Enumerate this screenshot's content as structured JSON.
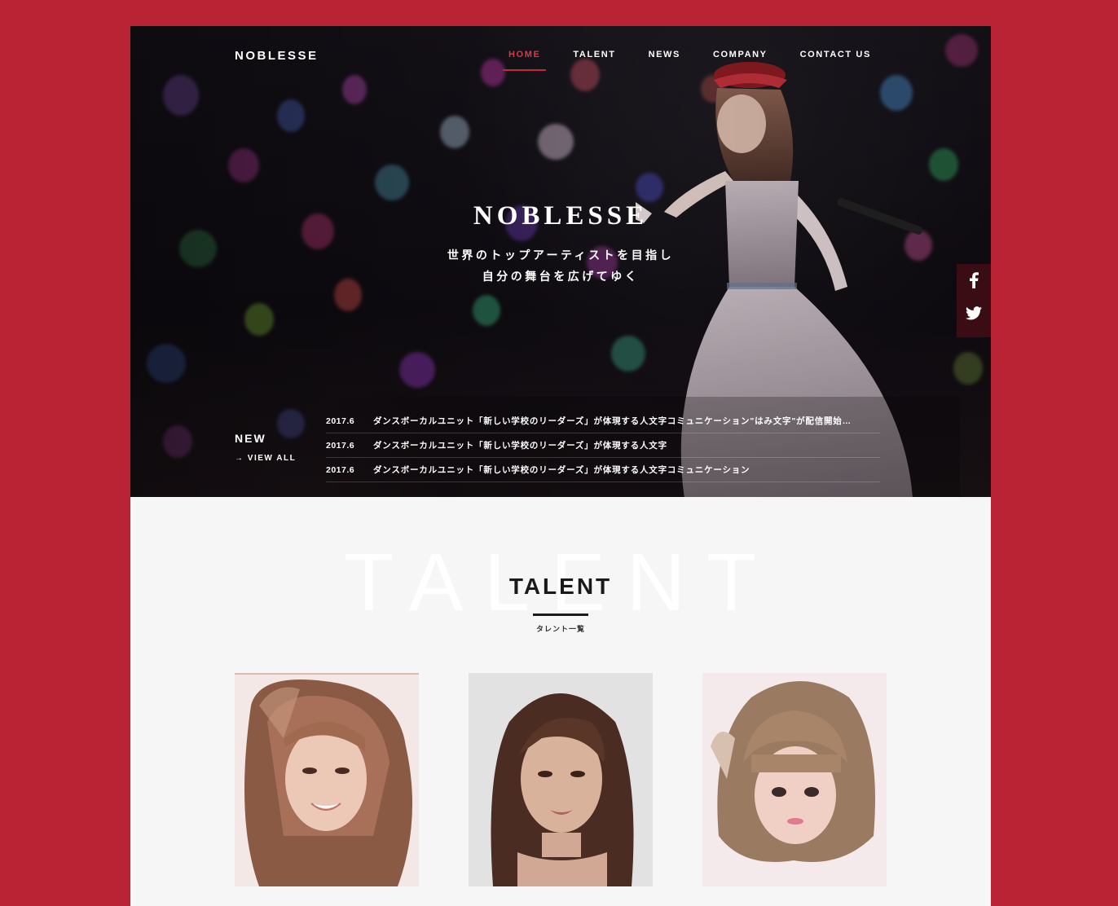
{
  "header": {
    "logo": "NOBLESSE",
    "nav": [
      {
        "label": "HOME",
        "active": true
      },
      {
        "label": "TALENT",
        "active": false
      },
      {
        "label": "NEWS",
        "active": false
      },
      {
        "label": "COMPANY",
        "active": false
      },
      {
        "label": "CONTACT US",
        "active": false
      }
    ]
  },
  "hero": {
    "title": "NOBLESSE",
    "copy_line1": "世界のトップアーティストを目指し",
    "copy_line2": "自分の舞台を広げてゆく"
  },
  "social": {
    "icons": [
      "facebook-icon",
      "twitter-icon"
    ]
  },
  "news": {
    "label": "NEW",
    "view_all": "→ VIEW ALL",
    "items": [
      {
        "date": "2017.6",
        "text": "ダンスボーカルユニット「新しい学校のリーダーズ」が体現する人文字コミュニケーション\"はみ文字\"が配信開始…"
      },
      {
        "date": "2017.6",
        "text": "ダンスボーカルユニット「新しい学校のリーダーズ」が体現する人文字"
      },
      {
        "date": "2017.6",
        "text": "ダンスボーカルユニット「新しい学校のリーダーズ」が体現する人文字コミュニケーション"
      }
    ]
  },
  "talent": {
    "bg_text": "TALENT",
    "heading": "TALENT",
    "subtitle": "タレント一覧"
  },
  "colors": {
    "outer_background": "#b92334",
    "accent": "#c02a3a",
    "page_background": "#f6f6f6"
  }
}
